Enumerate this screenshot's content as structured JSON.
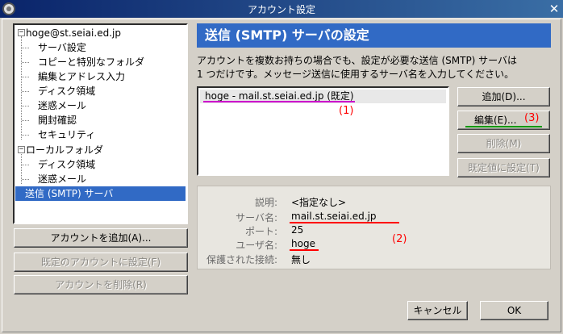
{
  "window": {
    "title": "アカウント設定"
  },
  "tree": {
    "account": "hoge@st.seiai.ed.jp",
    "account_children": [
      "サーバ設定",
      "コピーと特別なフォルダ",
      "編集とアドレス入力",
      "ディスク領域",
      "迷惑メール",
      "開封確認",
      "セキュリティ"
    ],
    "local": "ローカルフォルダ",
    "local_children": [
      "ディスク領域",
      "迷惑メール"
    ],
    "smtp": "送信 (SMTP) サーバ",
    "expander_symbol": "−"
  },
  "left_buttons": {
    "add_account": "アカウントを追加(A)...",
    "set_default": "既定のアカウントに設定(F)",
    "remove_account": "アカウントを削除(R)"
  },
  "main": {
    "heading": "送信 (SMTP) サーバの設定",
    "description_line1": "アカウントを複数お持ちの場合でも、設定が必要な送信 (SMTP) サーバは",
    "description_line2": "1 つだけです。メッセージ送信に使用するサーバ名を入力してください。",
    "servers": [
      {
        "label": "hoge - mail.st.seiai.ed.jp (既定)"
      }
    ]
  },
  "side_buttons": {
    "add": "追加(D)...",
    "edit": "編集(E)...",
    "delete": "削除(M)",
    "set_default": "既定値に設定(T)"
  },
  "annotations": {
    "a1": "(1)",
    "a2": "(2)",
    "a3": "(3)"
  },
  "details": {
    "description_label": "説明:",
    "description_value": "<指定なし>",
    "server_label": "サーバ名:",
    "server_value": "mail.st.seiai.ed.jp",
    "port_label": "ポート:",
    "port_value": "25",
    "user_label": "ユーザ名:",
    "user_value": "hoge",
    "secure_label": "保護された接続:",
    "secure_value": "無し"
  },
  "footer": {
    "cancel": "キャンセル",
    "ok": "OK"
  },
  "colors": {
    "accent": "#316ac5",
    "annotation_red": "#ff0000",
    "underline_magenta": "#cc00cc",
    "underline_green": "#009900"
  }
}
